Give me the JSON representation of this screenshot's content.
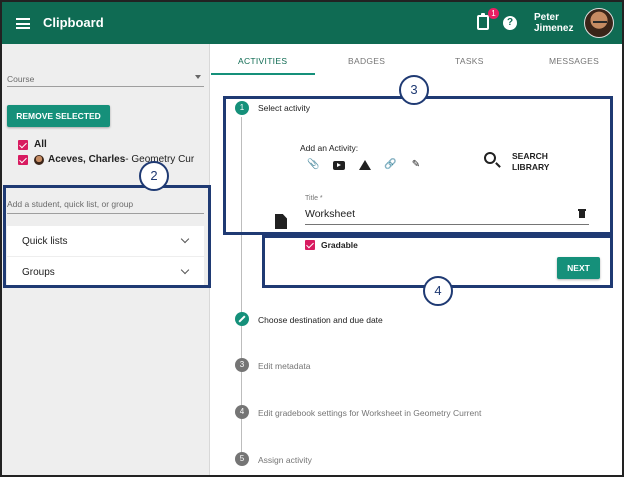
{
  "header": {
    "app_title": "Clipboard",
    "notification_count": "1",
    "help_glyph": "?",
    "user_first_name": "Peter",
    "user_last_name": "Jimenez",
    "bar_color": "#0f6b53"
  },
  "sidebar": {
    "course_label": "Course",
    "remove_button": "REMOVE SELECTED",
    "selection": {
      "all_label": "All",
      "student_name": "Aceves, Charles",
      "student_suffix": " - Geometry Cur"
    },
    "add_placeholder": "Add a student, quick list, or group",
    "panels": [
      {
        "label": "Quick lists"
      },
      {
        "label": "Groups"
      }
    ]
  },
  "tabs": [
    {
      "label": "ACTIVITIES",
      "active": true
    },
    {
      "label": "BADGES",
      "active": false
    },
    {
      "label": "TASKS",
      "active": false
    },
    {
      "label": "MESSAGES",
      "active": false
    }
  ],
  "steps": [
    {
      "num": "1",
      "label": "Select activity",
      "state": "active"
    },
    {
      "num": "",
      "label": "Choose destination and due date",
      "state": "editable"
    },
    {
      "num": "3",
      "label": "Edit metadata",
      "state": "pending"
    },
    {
      "num": "4",
      "label": "Edit gradebook settings for Worksheet in Geometry Current",
      "state": "pending"
    },
    {
      "num": "5",
      "label": "Assign activity",
      "state": "pending"
    }
  ],
  "activity": {
    "add_label": "Add an Activity:",
    "tools": [
      "attachment-icon",
      "youtube-icon",
      "drive-icon",
      "link-icon",
      "pencil-icon"
    ],
    "search_line1": "SEARCH",
    "search_line2": "LIBRARY",
    "title_label": "Title *",
    "title_value": "Worksheet",
    "gradable_label": "Gradable",
    "next_button": "NEXT"
  },
  "callouts": [
    "2",
    "3",
    "4"
  ],
  "colors": {
    "accent": "#15907a",
    "checkbox": "#d81b60",
    "callout": "#1f3a73"
  }
}
